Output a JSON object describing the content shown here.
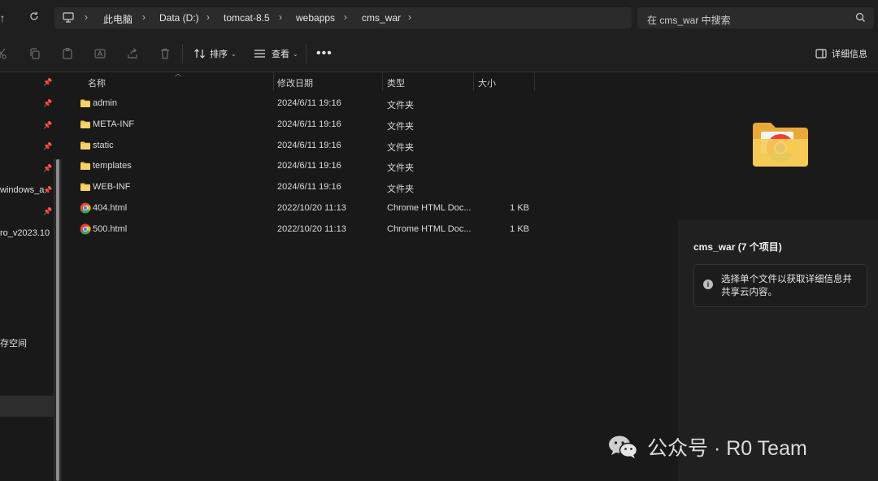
{
  "nav": {
    "up_icon": "arrow-up-icon",
    "refresh_icon": "refresh-icon"
  },
  "breadcrumb": [
    "此电脑",
    "Data (D:)",
    "tomcat-8.5",
    "webapps",
    "cms_war"
  ],
  "search": {
    "placeholder": "在 cms_war 中搜索"
  },
  "toolbar": {
    "sort_label": "排序",
    "view_label": "查看",
    "details_label": "详细信息"
  },
  "sidebar": {
    "items": [
      {
        "label": ""
      },
      {
        "label": ""
      },
      {
        "label": ""
      },
      {
        "label": ""
      },
      {
        "label": ""
      },
      {
        "label": "windows_a"
      },
      {
        "label": ""
      },
      {
        "label": "ro_v2023.10"
      },
      {
        "label": "存空间"
      }
    ]
  },
  "columns": {
    "name": "名称",
    "modified": "修改日期",
    "type": "类型",
    "size": "大小"
  },
  "files": [
    {
      "name": "admin",
      "modified": "2024/6/11 19:16",
      "type": "文件夹",
      "size": "",
      "icon": "folder-icon"
    },
    {
      "name": "META-INF",
      "modified": "2024/6/11 19:16",
      "type": "文件夹",
      "size": "",
      "icon": "folder-icon"
    },
    {
      "name": "static",
      "modified": "2024/6/11 19:16",
      "type": "文件夹",
      "size": "",
      "icon": "folder-icon"
    },
    {
      "name": "templates",
      "modified": "2024/6/11 19:16",
      "type": "文件夹",
      "size": "",
      "icon": "folder-icon"
    },
    {
      "name": "WEB-INF",
      "modified": "2024/6/11 19:16",
      "type": "文件夹",
      "size": "",
      "icon": "folder-icon"
    },
    {
      "name": "404.html",
      "modified": "2022/10/20 11:13",
      "type": "Chrome HTML Doc...",
      "size": "1 KB",
      "icon": "chrome-file-icon"
    },
    {
      "name": "500.html",
      "modified": "2022/10/20 11:13",
      "type": "Chrome HTML Doc...",
      "size": "1 KB",
      "icon": "chrome-file-icon"
    }
  ],
  "details": {
    "title": "cms_war (7 个项目)",
    "info_text": "选择单个文件以获取详细信息并共享云内容。"
  },
  "watermark": {
    "text": "公众号 · R0 Team"
  }
}
